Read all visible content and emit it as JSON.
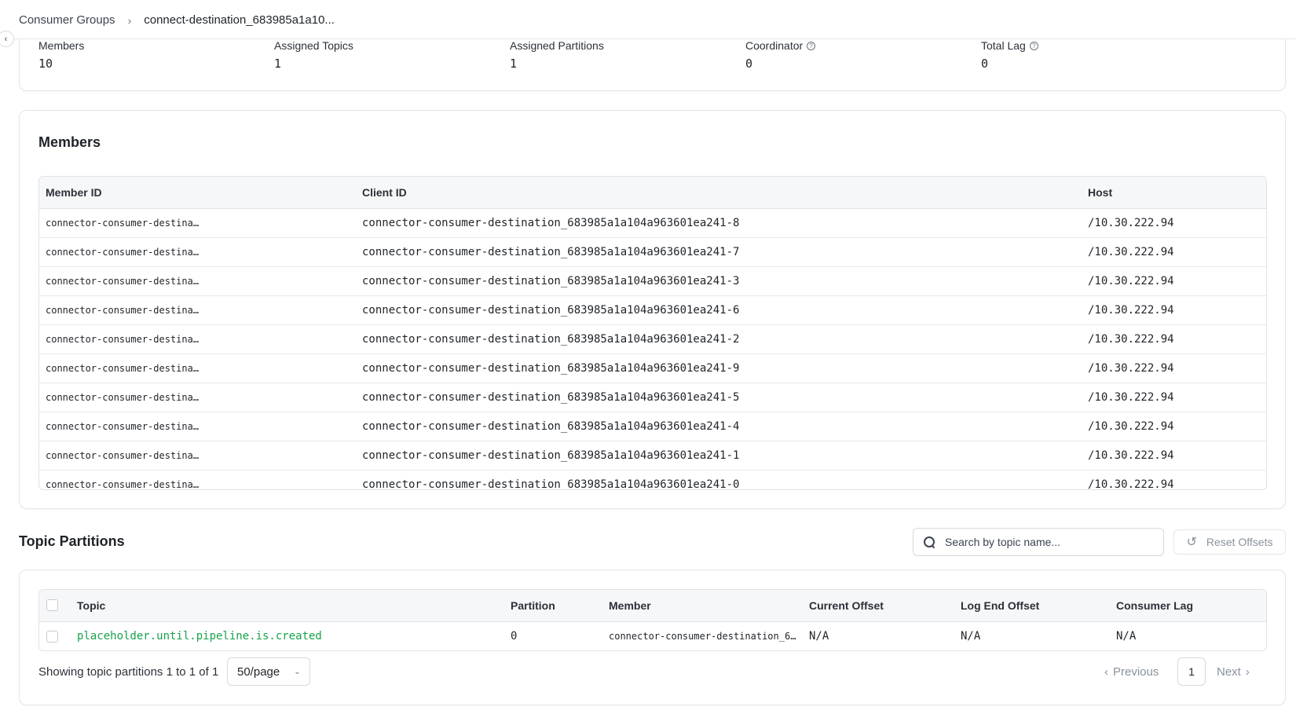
{
  "breadcrumb": {
    "parent": "Consumer Groups",
    "separator": "›",
    "current": "connect-destination_683985a1a10..."
  },
  "stats": [
    {
      "label": "Members",
      "value": "10",
      "help": false
    },
    {
      "label": "Assigned Topics",
      "value": "1",
      "help": false
    },
    {
      "label": "Assigned Partitions",
      "value": "1",
      "help": false
    },
    {
      "label": "Coordinator",
      "value": "0",
      "help": true
    },
    {
      "label": "Total Lag",
      "value": "0",
      "help": true
    }
  ],
  "members": {
    "title": "Members",
    "columns": [
      "Member ID",
      "Client ID",
      "Host"
    ],
    "rows": [
      {
        "member_id": "connector-consumer-destina…",
        "client_id": "connector-consumer-destination_683985a1a104a963601ea241-8",
        "host": "/10.30.222.94"
      },
      {
        "member_id": "connector-consumer-destina…",
        "client_id": "connector-consumer-destination_683985a1a104a963601ea241-7",
        "host": "/10.30.222.94"
      },
      {
        "member_id": "connector-consumer-destina…",
        "client_id": "connector-consumer-destination_683985a1a104a963601ea241-3",
        "host": "/10.30.222.94"
      },
      {
        "member_id": "connector-consumer-destina…",
        "client_id": "connector-consumer-destination_683985a1a104a963601ea241-6",
        "host": "/10.30.222.94"
      },
      {
        "member_id": "connector-consumer-destina…",
        "client_id": "connector-consumer-destination_683985a1a104a963601ea241-2",
        "host": "/10.30.222.94"
      },
      {
        "member_id": "connector-consumer-destina…",
        "client_id": "connector-consumer-destination_683985a1a104a963601ea241-9",
        "host": "/10.30.222.94"
      },
      {
        "member_id": "connector-consumer-destina…",
        "client_id": "connector-consumer-destination_683985a1a104a963601ea241-5",
        "host": "/10.30.222.94"
      },
      {
        "member_id": "connector-consumer-destina…",
        "client_id": "connector-consumer-destination_683985a1a104a963601ea241-4",
        "host": "/10.30.222.94"
      },
      {
        "member_id": "connector-consumer-destina…",
        "client_id": "connector-consumer-destination_683985a1a104a963601ea241-1",
        "host": "/10.30.222.94"
      },
      {
        "member_id": "connector-consumer-destina…",
        "client_id": "connector-consumer-destination_683985a1a104a963601ea241-0",
        "host": "/10.30.222.94"
      }
    ]
  },
  "topic_partitions": {
    "title": "Topic Partitions",
    "search_placeholder": "Search by topic name...",
    "reset_label": "Reset Offsets",
    "columns": [
      "Topic",
      "Partition",
      "Member",
      "Current Offset",
      "Log End Offset",
      "Consumer Lag"
    ],
    "rows": [
      {
        "topic": "placeholder.until.pipeline.is.created",
        "partition": "0",
        "member": "connector-consumer-destination_6…",
        "current_offset": "N/A",
        "log_end_offset": "N/A",
        "consumer_lag": "N/A"
      }
    ],
    "showing_text": "Showing topic partitions 1 to 1 of 1",
    "page_size": "50/page",
    "prev_label": "Previous",
    "current_page": "1",
    "next_label": "Next",
    "topic_color": "#16a34a"
  }
}
